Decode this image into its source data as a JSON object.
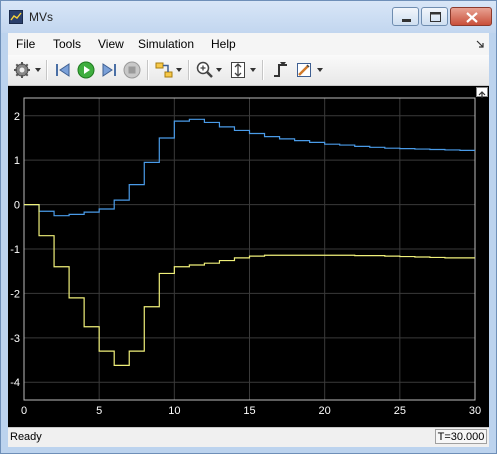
{
  "window": {
    "title": "MVs"
  },
  "menu": {
    "items": [
      "File",
      "Tools",
      "View",
      "Simulation",
      "Help"
    ]
  },
  "toolbar": {
    "buttons": [
      "settings-icon",
      "step-back-icon",
      "run-icon",
      "step-forward-icon",
      "stop-icon",
      "highlight-icon",
      "zoom-icon",
      "scale-icon",
      "triggers-icon",
      "style-icon"
    ]
  },
  "status": {
    "text": "Ready",
    "time": "T=30.000"
  },
  "colors": {
    "series1": "#4a9be8",
    "series2": "#f0f07a",
    "plot_bg": "#000000",
    "grid": "#3a3a3a",
    "axis": "#ffffff"
  },
  "chart_data": {
    "type": "line",
    "title": "",
    "xlabel": "",
    "ylabel": "",
    "xlim": [
      0,
      30
    ],
    "ylim": [
      -4.4,
      2.4
    ],
    "xticks": [
      0,
      5,
      10,
      15,
      20,
      25,
      30
    ],
    "yticks": [
      2,
      1,
      0,
      -1,
      -2,
      -3,
      -4
    ],
    "grid": true,
    "legend": "none",
    "series": [
      {
        "color": "#4a9be8",
        "step": true,
        "x": [
          0,
          1,
          2,
          3,
          4,
          5,
          6,
          7,
          8,
          9,
          10,
          11,
          12,
          13,
          14,
          15,
          16,
          17,
          18,
          19,
          20,
          21,
          22,
          23,
          24,
          25,
          26,
          27,
          28,
          29
        ],
        "y": [
          0.0,
          -0.15,
          -0.25,
          -0.22,
          -0.17,
          -0.1,
          0.1,
          0.45,
          0.95,
          1.5,
          1.88,
          1.92,
          1.85,
          1.75,
          1.67,
          1.6,
          1.53,
          1.48,
          1.44,
          1.4,
          1.36,
          1.34,
          1.31,
          1.29,
          1.27,
          1.26,
          1.25,
          1.24,
          1.23,
          1.22
        ]
      },
      {
        "color": "#f0f07a",
        "step": true,
        "x": [
          0,
          1,
          2,
          3,
          4,
          5,
          6,
          7,
          8,
          9,
          10,
          11,
          12,
          13,
          14,
          15,
          16,
          17,
          18,
          19,
          20,
          21,
          22,
          23,
          24,
          25,
          26,
          27,
          28,
          29
        ],
        "y": [
          0.0,
          -0.7,
          -1.4,
          -2.1,
          -2.75,
          -3.3,
          -3.62,
          -3.3,
          -2.3,
          -1.55,
          -1.4,
          -1.36,
          -1.32,
          -1.26,
          -1.2,
          -1.16,
          -1.14,
          -1.14,
          -1.14,
          -1.14,
          -1.14,
          -1.14,
          -1.15,
          -1.15,
          -1.16,
          -1.17,
          -1.18,
          -1.19,
          -1.2,
          -1.2
        ]
      }
    ]
  }
}
